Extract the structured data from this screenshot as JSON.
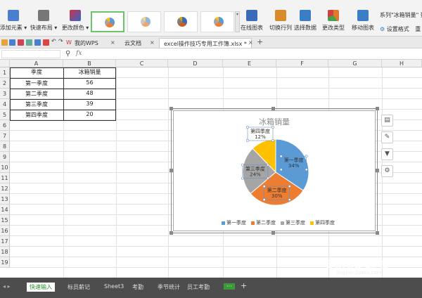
{
  "ribbon": {
    "buttons": [
      {
        "label": "添加元素 ▾",
        "icon": "add-element-icon",
        "color": "#4a7fd0"
      },
      {
        "label": "快速布局 ▾",
        "icon": "quick-layout-icon",
        "color": "#777777"
      },
      {
        "label": "更改颜色 ▾",
        "icon": "change-color-icon",
        "color": "#cc3344"
      },
      {
        "label": "在线图表",
        "icon": "online-chart-icon",
        "color": "#3a6bb8"
      },
      {
        "label": "切换行列",
        "icon": "switch-row-col-icon",
        "color": "#d98a2b"
      },
      {
        "label": "选择数据",
        "icon": "select-data-icon",
        "color": "#3a7ec5"
      },
      {
        "label": "更改类型",
        "icon": "change-type-icon",
        "color": "#e07a2a"
      },
      {
        "label": "移动图表",
        "icon": "move-chart-icon",
        "color": "#3a7ec5"
      }
    ],
    "series_dropdown": "系列\"冰箱销量\" 数",
    "set_format": "设置格式",
    "reset_style": "重"
  },
  "tabs": [
    {
      "label": "我的WPS"
    },
    {
      "label": "云文档"
    },
    {
      "label": "excel操作技巧专用工作簿.xlsx *"
    }
  ],
  "formula_bar": {
    "zoom_icon": "magnify-icon",
    "fx": "fx"
  },
  "columns": [
    "A",
    "B",
    "C",
    "D",
    "E",
    "F",
    "G",
    "H"
  ],
  "rows": [
    "1",
    "2",
    "3",
    "4",
    "5",
    "6",
    "7",
    "8",
    "9",
    "10",
    "11",
    "12",
    "13",
    "14",
    "15",
    "16",
    "17",
    "18",
    "19",
    "20",
    "21",
    "22",
    "23",
    "24",
    "25"
  ],
  "table": {
    "headers": [
      "季度",
      "冰箱销量"
    ],
    "rows": [
      [
        "第一季度",
        "56"
      ],
      [
        "第二季度",
        "48"
      ],
      [
        "第三季度",
        "39"
      ],
      [
        "第四季度",
        "20"
      ]
    ]
  },
  "chart_data": {
    "type": "pie",
    "title": "冰箱销量",
    "categories": [
      "第一季度",
      "第二季度",
      "第三季度",
      "第四季度"
    ],
    "values": [
      56,
      48,
      39,
      20
    ],
    "percent_labels": [
      "34%",
      "30%",
      "24%",
      "12%"
    ],
    "colors": [
      "#5b9bd5",
      "#ed7d31",
      "#a5a5a5",
      "#ffc000"
    ],
    "legend_position": "bottom"
  },
  "chart_tools": [
    {
      "icon": "chart-elements-icon",
      "glyph": "▤"
    },
    {
      "icon": "chart-style-icon",
      "glyph": "✎"
    },
    {
      "icon": "chart-filter-icon",
      "glyph": "▼"
    },
    {
      "icon": "chart-settings-icon",
      "glyph": "⚙"
    }
  ],
  "sheet_tabs": [
    "快速输入",
    "标员薪记",
    "Sheet3",
    "考勤",
    "季节统计",
    "员工考勤"
  ],
  "watermark": {
    "text": "Baidu 经验",
    "sub": "jingyan.baidu.com"
  }
}
